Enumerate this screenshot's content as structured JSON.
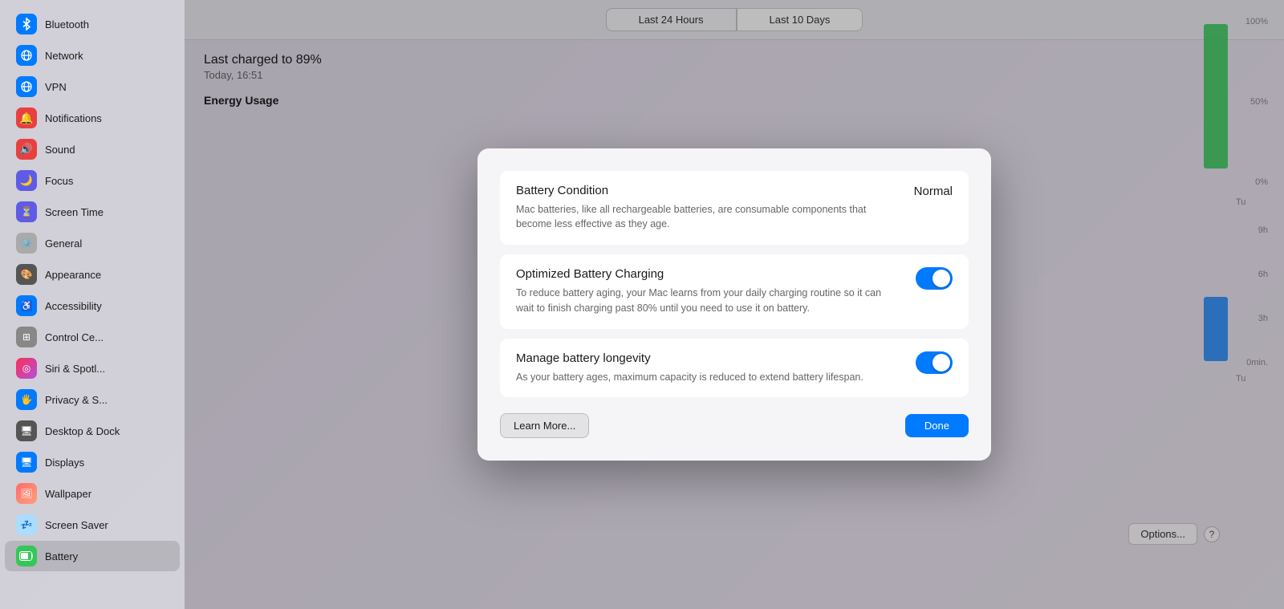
{
  "background": {
    "gradient_start": "#4a0080",
    "gradient_end": "#ff88ff"
  },
  "sidebar": {
    "items": [
      {
        "id": "bluetooth",
        "label": "Bluetooth",
        "icon": "bluetooth",
        "icon_bg": "#007aff",
        "active": false
      },
      {
        "id": "network",
        "label": "Network",
        "icon": "network",
        "icon_bg": "#007aff",
        "active": false
      },
      {
        "id": "vpn",
        "label": "VPN",
        "icon": "vpn",
        "icon_bg": "#007aff",
        "active": false
      },
      {
        "id": "notifications",
        "label": "Notifications",
        "icon": "notifications",
        "icon_bg": "#e84040",
        "active": false
      },
      {
        "id": "sound",
        "label": "Sound",
        "icon": "sound",
        "icon_bg": "#e84040",
        "active": false
      },
      {
        "id": "focus",
        "label": "Focus",
        "icon": "focus",
        "icon_bg": "#5e5ce6",
        "active": false
      },
      {
        "id": "screen-time",
        "label": "Screen Time",
        "icon": "screen-time",
        "icon_bg": "#5e5ce6",
        "active": false
      },
      {
        "id": "general",
        "label": "General",
        "icon": "general",
        "icon_bg": "#aaaaaa",
        "active": false
      },
      {
        "id": "appearance",
        "label": "Appearance",
        "icon": "appearance",
        "icon_bg": "#555555",
        "active": false
      },
      {
        "id": "accessibility",
        "label": "Accessibility",
        "icon": "accessibility",
        "icon_bg": "#007aff",
        "active": false
      },
      {
        "id": "control-center",
        "label": "Control Ce...",
        "icon": "control-center",
        "icon_bg": "#888888",
        "active": false
      },
      {
        "id": "siri-spotlight",
        "label": "Siri & Spotl...",
        "icon": "siri",
        "icon_bg": "#888888",
        "active": false
      },
      {
        "id": "privacy",
        "label": "Privacy & S...",
        "icon": "privacy",
        "icon_bg": "#007aff",
        "active": false
      },
      {
        "id": "desktop-dock",
        "label": "Desktop & Dock",
        "icon": "desktop",
        "icon_bg": "#555555",
        "active": false
      },
      {
        "id": "displays",
        "label": "Displays",
        "icon": "displays",
        "icon_bg": "#007aff",
        "active": false
      },
      {
        "id": "wallpaper",
        "label": "Wallpaper",
        "icon": "wallpaper",
        "icon_bg": "#ff6b6b",
        "active": false
      },
      {
        "id": "screen-saver",
        "label": "Screen Saver",
        "icon": "screen-saver",
        "icon_bg": "#aaddff",
        "active": false
      },
      {
        "id": "battery",
        "label": "Battery",
        "icon": "battery",
        "icon_bg": "#34c759",
        "active": true
      }
    ]
  },
  "main": {
    "tabs": [
      {
        "id": "last24h",
        "label": "Last 24 Hours",
        "active": false
      },
      {
        "id": "last10d",
        "label": "Last 10 Days",
        "active": true
      }
    ],
    "battery_info": {
      "charged_text": "Last charged to 89%",
      "time_text": "Today, 16:51"
    },
    "energy_usage_label": "Energy Usage",
    "chart_y_labels": [
      "100%",
      "50%",
      "0%"
    ],
    "chart_time_labels": [
      "Tu"
    ],
    "chart_right_labels": [
      "9h",
      "6h",
      "3h",
      "0min."
    ],
    "chart_right_time": "Tu",
    "options_btn": "Options...",
    "help_btn": "?"
  },
  "modal": {
    "sections": [
      {
        "id": "battery-condition",
        "title": "Battery Condition",
        "value": "Normal",
        "description": "Mac batteries, like all rechargeable batteries, are consumable components that become less effective as they age.",
        "has_toggle": false
      },
      {
        "id": "optimized-charging",
        "title": "Optimized Battery Charging",
        "description": "To reduce battery aging, your Mac learns from your daily charging routine so it can wait to finish charging past 80% until you need to use it on battery.",
        "has_toggle": true,
        "toggle_on": true
      },
      {
        "id": "manage-longevity",
        "title": "Manage battery longevity",
        "description": "As your battery ages, maximum capacity is reduced to extend battery lifespan.",
        "has_toggle": true,
        "toggle_on": true
      }
    ],
    "learn_more_btn": "Learn More...",
    "done_btn": "Done"
  }
}
